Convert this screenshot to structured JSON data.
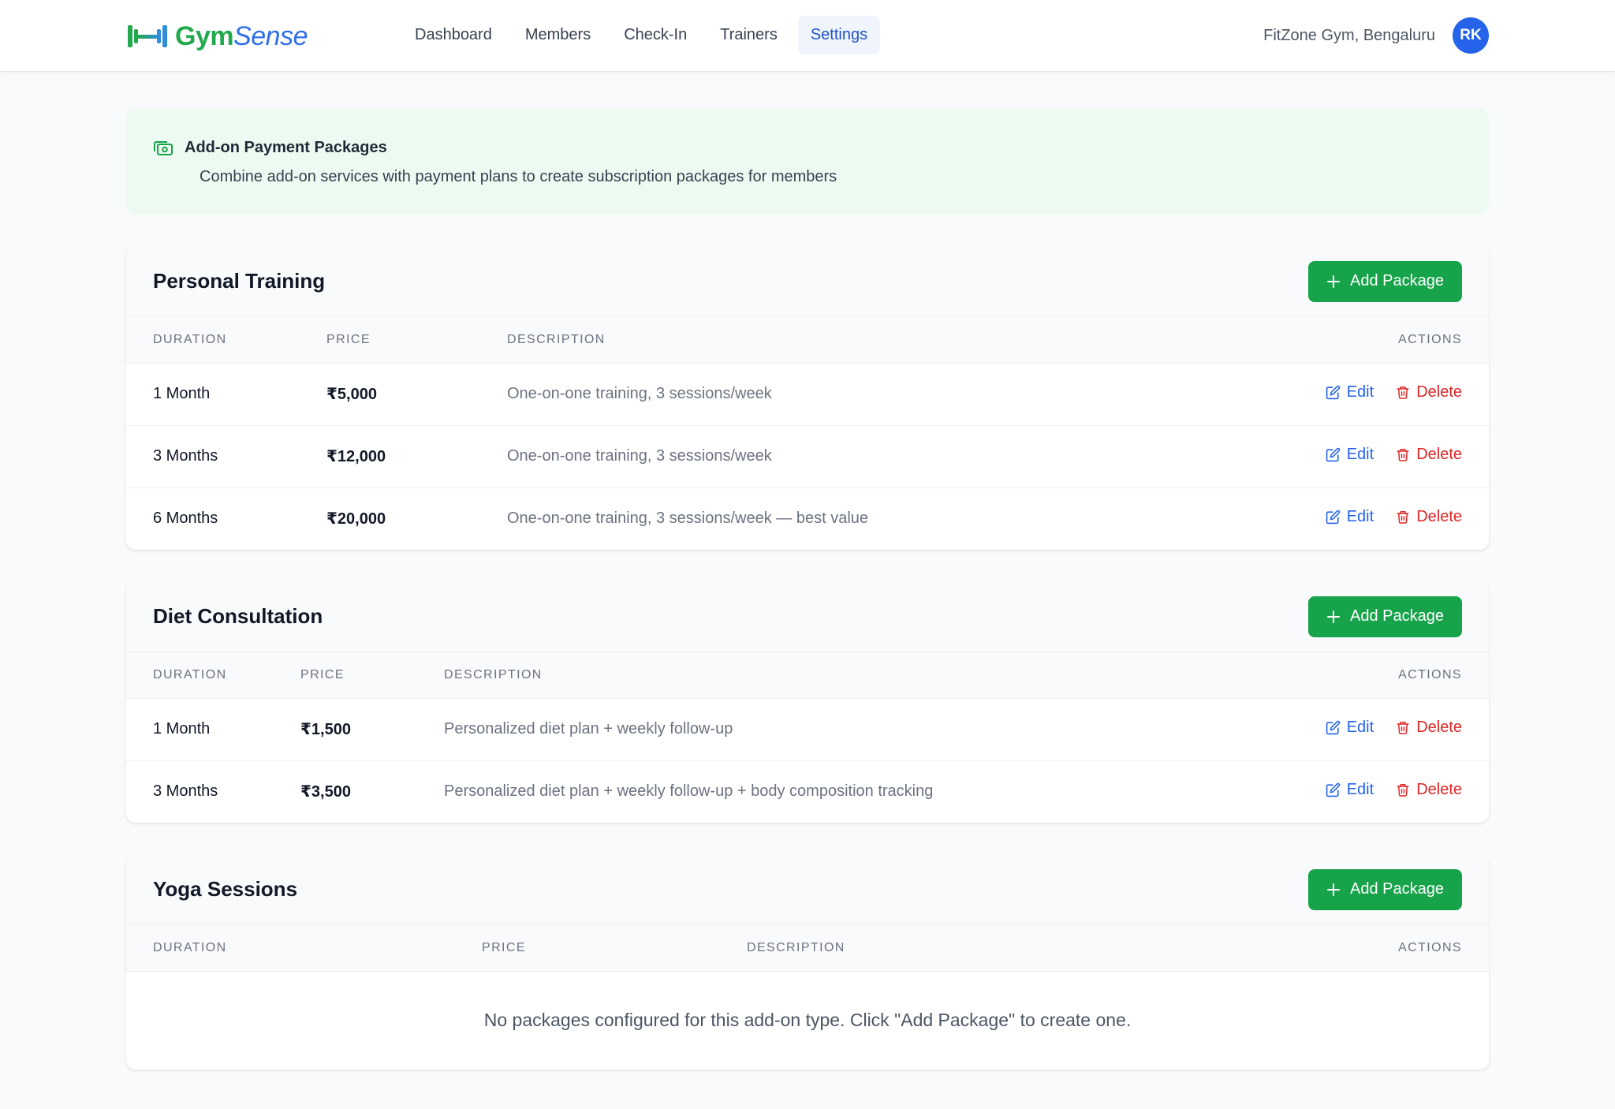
{
  "brand": {
    "name_a": "Gym",
    "name_b": "Sense"
  },
  "nav": {
    "links": [
      "Dashboard",
      "Members",
      "Check-In",
      "Trainers",
      "Settings"
    ],
    "active_index": 4
  },
  "header": {
    "gym_name": "FitZone Gym, Bengaluru",
    "avatar_initials": "RK"
  },
  "banner": {
    "icon": "money-icon",
    "title": "Add-on Payment Packages",
    "description": "Combine add-on services with payment plans to create subscription packages for members"
  },
  "columns": {
    "duration": "DURATION",
    "price": "PRICE",
    "description": "DESCRIPTION",
    "actions": "ACTIONS"
  },
  "labels": {
    "add_package": "Add Package",
    "edit": "Edit",
    "delete": "Delete"
  },
  "colors": {
    "accent": "#2563eb",
    "primary_green": "#16a34a",
    "danger": "#dc2626",
    "banner_bg": "#edfaf1"
  },
  "sections": [
    {
      "title": "Personal Training",
      "rows": [
        {
          "duration": "1 Month",
          "price": "₹5,000",
          "description": "One-on-one training, 3 sessions/week"
        },
        {
          "duration": "3 Months",
          "price": "₹12,000",
          "description": "One-on-one training, 3 sessions/week"
        },
        {
          "duration": "6 Months",
          "price": "₹20,000",
          "description": "One-on-one training, 3 sessions/week — best value"
        }
      ]
    },
    {
      "title": "Diet Consultation",
      "rows": [
        {
          "duration": "1 Month",
          "price": "₹1,500",
          "description": "Personalized diet plan + weekly follow-up"
        },
        {
          "duration": "3 Months",
          "price": "₹3,500",
          "description": "Personalized diet plan + weekly follow-up + body composition tracking"
        }
      ]
    },
    {
      "title": "Yoga Sessions",
      "rows": [],
      "empty_message": "No packages configured for this add-on type. Click \"Add Package\" to create one."
    }
  ]
}
